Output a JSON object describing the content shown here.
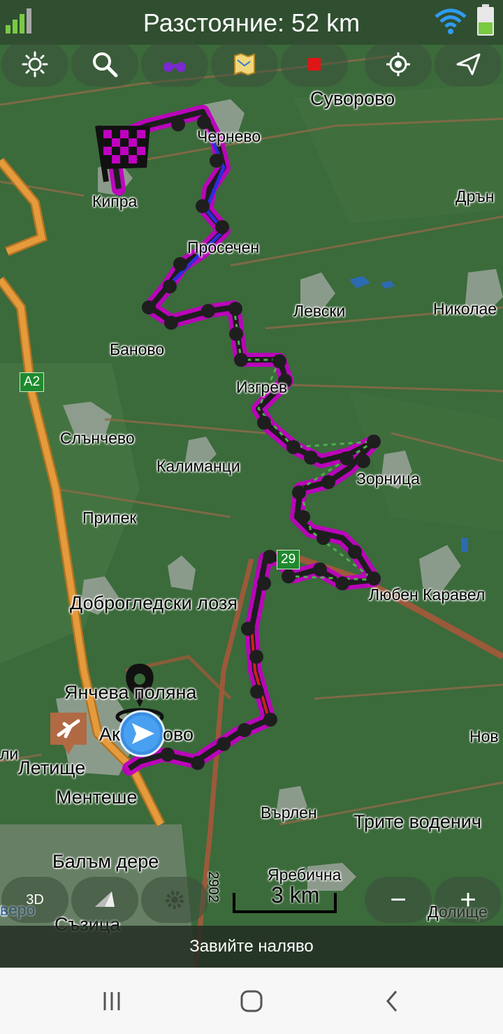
{
  "status": {
    "title": "Разстояние: 52 km"
  },
  "toolbar": {
    "buttons": [
      "brightness-icon",
      "search-icon",
      "binoculars-icon",
      "map-icon",
      "stop-icon",
      "locate-icon",
      "navigate-icon"
    ]
  },
  "map": {
    "towns": [
      {
        "name": "Суворово",
        "size": "med"
      },
      {
        "name": "Чернево",
        "size": "sm"
      },
      {
        "name": "Кипра",
        "size": "sm"
      },
      {
        "name": "Дрън",
        "size": "sm"
      },
      {
        "name": "Просечен",
        "size": "sm"
      },
      {
        "name": "Левски",
        "size": "sm"
      },
      {
        "name": "Николае",
        "size": "sm"
      },
      {
        "name": "Баново",
        "size": "sm"
      },
      {
        "name": "Изгрев",
        "size": "sm"
      },
      {
        "name": "Слънчево",
        "size": "sm"
      },
      {
        "name": "Калиманци",
        "size": "sm"
      },
      {
        "name": "Зорница",
        "size": "sm"
      },
      {
        "name": "Припек",
        "size": "sm"
      },
      {
        "name": "Любен Каравел",
        "size": "sm"
      },
      {
        "name": "Доброгледски лозя",
        "size": "med"
      },
      {
        "name": "Янчева поляна",
        "size": "med"
      },
      {
        "name": "Ак",
        "size": "med"
      },
      {
        "name": "ово",
        "size": "med"
      },
      {
        "name": "Нов",
        "size": "sm"
      },
      {
        "name": "ли",
        "size": "sm"
      },
      {
        "name": "Летище",
        "size": "med"
      },
      {
        "name": "Ментеше",
        "size": "med"
      },
      {
        "name": "Върлен",
        "size": "sm"
      },
      {
        "name": "Трите воденич",
        "size": "med"
      },
      {
        "name": "Балъм дере",
        "size": "med"
      },
      {
        "name": "Яребична",
        "size": "sm"
      },
      {
        "name": "Съзица",
        "size": "med"
      },
      {
        "name": "Долище",
        "size": "sm"
      },
      {
        "name": "веро",
        "size": "sm"
      }
    ],
    "road_badges": [
      "A2",
      "29"
    ],
    "road_number": "2902",
    "scale": "3 km",
    "colors": {
      "terrain": "#3b6a3b",
      "route": "#c000c0",
      "highway": "#e59a3c",
      "main_road": "#9b5a3a"
    }
  },
  "bottom_controls": {
    "mode_3d": "3D",
    "zoom_out": "−",
    "zoom_in": "+"
  },
  "instruction": "Завийте наляво",
  "nav": {
    "buttons": [
      "recent-apps-icon",
      "home-icon",
      "back-icon"
    ]
  }
}
